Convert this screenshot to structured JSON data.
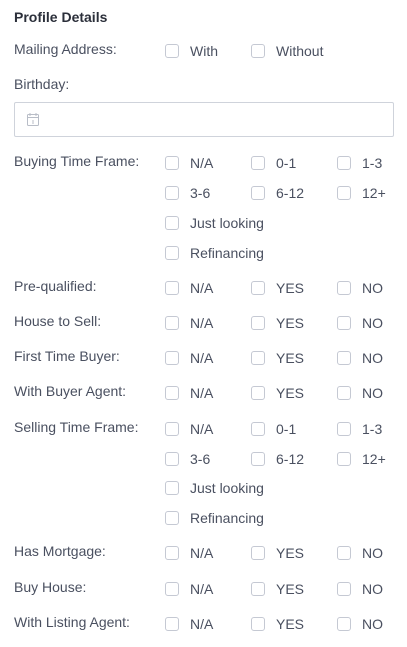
{
  "title": "Profile Details",
  "mailing": {
    "label": "Mailing Address:",
    "options": [
      "With",
      "Without"
    ]
  },
  "birthday": {
    "label": "Birthday:",
    "value": ""
  },
  "buying": {
    "label": "Buying Time Frame:",
    "options": [
      "N/A",
      "0-1",
      "1-3",
      "3-6",
      "6-12",
      "12+",
      "Just looking",
      "Refinancing"
    ]
  },
  "prequalified": {
    "label": "Pre-qualified:",
    "options": [
      "N/A",
      "YES",
      "NO"
    ]
  },
  "house_to_sell": {
    "label": "House to Sell:",
    "options": [
      "N/A",
      "YES",
      "NO"
    ]
  },
  "first_time_buyer": {
    "label": "First Time Buyer:",
    "options": [
      "N/A",
      "YES",
      "NO"
    ]
  },
  "with_buyer_agent": {
    "label": "With Buyer Agent:",
    "options": [
      "N/A",
      "YES",
      "NO"
    ]
  },
  "selling": {
    "label": "Selling Time Frame:",
    "options": [
      "N/A",
      "0-1",
      "1-3",
      "3-6",
      "6-12",
      "12+",
      "Just looking",
      "Refinancing"
    ]
  },
  "has_mortgage": {
    "label": "Has Mortgage:",
    "options": [
      "N/A",
      "YES",
      "NO"
    ]
  },
  "buy_house": {
    "label": "Buy House:",
    "options": [
      "N/A",
      "YES",
      "NO"
    ]
  },
  "with_listing_agent": {
    "label": "With Listing Agent:",
    "options": [
      "N/A",
      "YES",
      "NO"
    ]
  }
}
